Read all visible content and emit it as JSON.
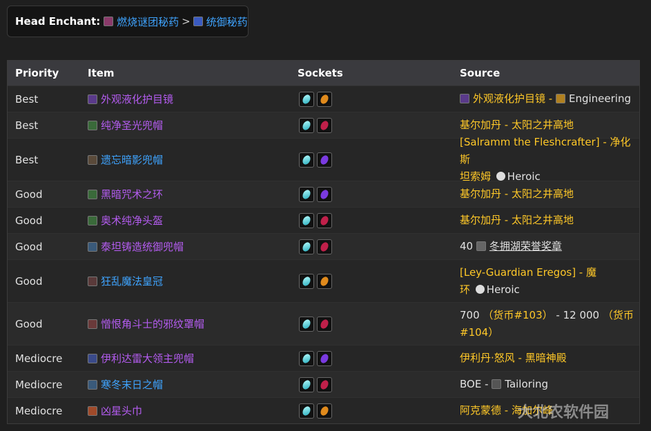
{
  "enchant": {
    "label": "Head Enchant",
    "link1": "燃烧谜团秘药",
    "sep": ">",
    "link2": "统御秘药"
  },
  "headers": {
    "priority": "Priority",
    "item": "Item",
    "sockets": "Sockets",
    "source": "Source"
  },
  "rows": [
    {
      "priority": "Best",
      "item": "外观液化护目镜",
      "src1": "外观液化护目镜",
      "src2": " - ",
      "src3": "Engineering"
    },
    {
      "priority": "Best",
      "item": "纯净圣光兜帽",
      "src1": "基尔加丹 - 太阳之井高地"
    },
    {
      "priority": "Best",
      "item": "遗忘暗影兜帽",
      "src1": "[Salramm the Fleshcrafter] - 净化斯",
      "src2": "坦索姆",
      "src3": "Heroic"
    },
    {
      "priority": "Good",
      "item": "黑暗咒术之环",
      "src1": "基尔加丹 - 太阳之井高地"
    },
    {
      "priority": "Good",
      "item": "奥术纯净头盔",
      "src1": "基尔加丹 - 太阳之井高地"
    },
    {
      "priority": "Good",
      "item": "泰坦铸造统御兜帽",
      "src1": "40",
      "src2": "冬拥湖荣誉奖章"
    },
    {
      "priority": "Good",
      "item": "狂乱魔法皇冠",
      "src1": "[Ley-Guardian Eregos] - 魔",
      "src2": "环",
      "src3": "Heroic"
    },
    {
      "priority": "Good",
      "item": "憎恨角斗士的邪纹罩帽",
      "src1": "700",
      "src2": "（货币#103）",
      "src3": "- 12 000",
      "src4": "（货币",
      "src5": "#104）"
    },
    {
      "priority": "Mediocre",
      "item": "伊利达雷大领主兜帽",
      "src1": "伊利丹·怒风 - 黑暗神殿"
    },
    {
      "priority": "Mediocre",
      "item": "寒冬末日之帽",
      "src1": "BOE - ",
      "src2": "Tailoring"
    },
    {
      "priority": "Mediocre",
      "item": "凶星头巾",
      "src1": "阿克蒙德 - 海加尔峰"
    }
  ],
  "watermark": "大北农软件园",
  "icons": {
    "gem-meta": "diamond-gem-icon",
    "gem-orange": "orange-gem-icon",
    "gem-red": "red-gem-icon",
    "gem-purple": "purple-gem-icon"
  }
}
